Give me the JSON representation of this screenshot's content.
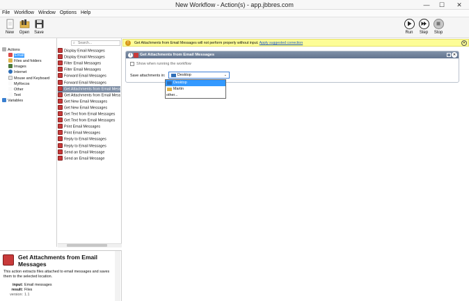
{
  "window": {
    "title": "New Workflow - Action(s) - app.jbbres.com",
    "min": "—",
    "max": "☐",
    "close": "✕"
  },
  "menu": [
    "File",
    "Workflow",
    "Window",
    "Options",
    "Help"
  ],
  "toolbar": {
    "new": "New",
    "open": "Open",
    "save": "Save",
    "run": "Run",
    "step": "Step",
    "stop": "Stop"
  },
  "tree": [
    {
      "label": "Actions",
      "icon": "actions-icon"
    },
    {
      "label": "Email",
      "icon": "email-icon",
      "selected": true
    },
    {
      "label": "Files and folders",
      "icon": "folder-icon"
    },
    {
      "label": "Images",
      "icon": "images-icon"
    },
    {
      "label": "Internet",
      "icon": "globe-icon"
    },
    {
      "label": "Mouse and Keyboard",
      "icon": "mouse-icon"
    },
    {
      "label": "MyRecos",
      "icon": "myrecos-icon"
    },
    {
      "label": "Other",
      "icon": "other-icon"
    },
    {
      "label": "Text",
      "icon": "text-icon"
    },
    {
      "label": "Variables",
      "icon": "variables-icon"
    }
  ],
  "search": {
    "placeholder": "Search..."
  },
  "actions": [
    "Display Email Messages",
    "Display Email Messages",
    "Filter Email Messages",
    "Filter Email Messages",
    "Forward Email Messages",
    "Forward Email Messages",
    "Get Attachments from Email Messages",
    "Get Attachments from Email Messages",
    "Get New Email Messages",
    "Get New Email Messages",
    "Get Text from Email Messages",
    "Get Text from Email Messages",
    "Print Email Messages",
    "Print Email Messages",
    "Reply to Email Messages",
    "Reply to Email Messages",
    "Send an Email Message",
    "Send an Email Message"
  ],
  "selected_action_index": 6,
  "description": {
    "title": "Get Attachments from Email Messages",
    "text": "This action extracts files attached to email messages and saves them to the selected location.",
    "input_label": "input:",
    "input_value": "Email messages",
    "result_label": "result:",
    "result_value": "Files",
    "version_label": "version:",
    "version_value": "1.1"
  },
  "warning": {
    "text": "Get Attachments from Email Messages will not perform properly without input.",
    "link": "Apply suggested correction"
  },
  "card": {
    "title": "Get Attachments from Email Messages",
    "info": "i",
    "close": "✕",
    "show_when_running": "Show when running the workflow",
    "save_label": "Save attachments in:",
    "selected": "Desktop",
    "options": [
      "Desktop",
      "Martin",
      "other..."
    ]
  }
}
